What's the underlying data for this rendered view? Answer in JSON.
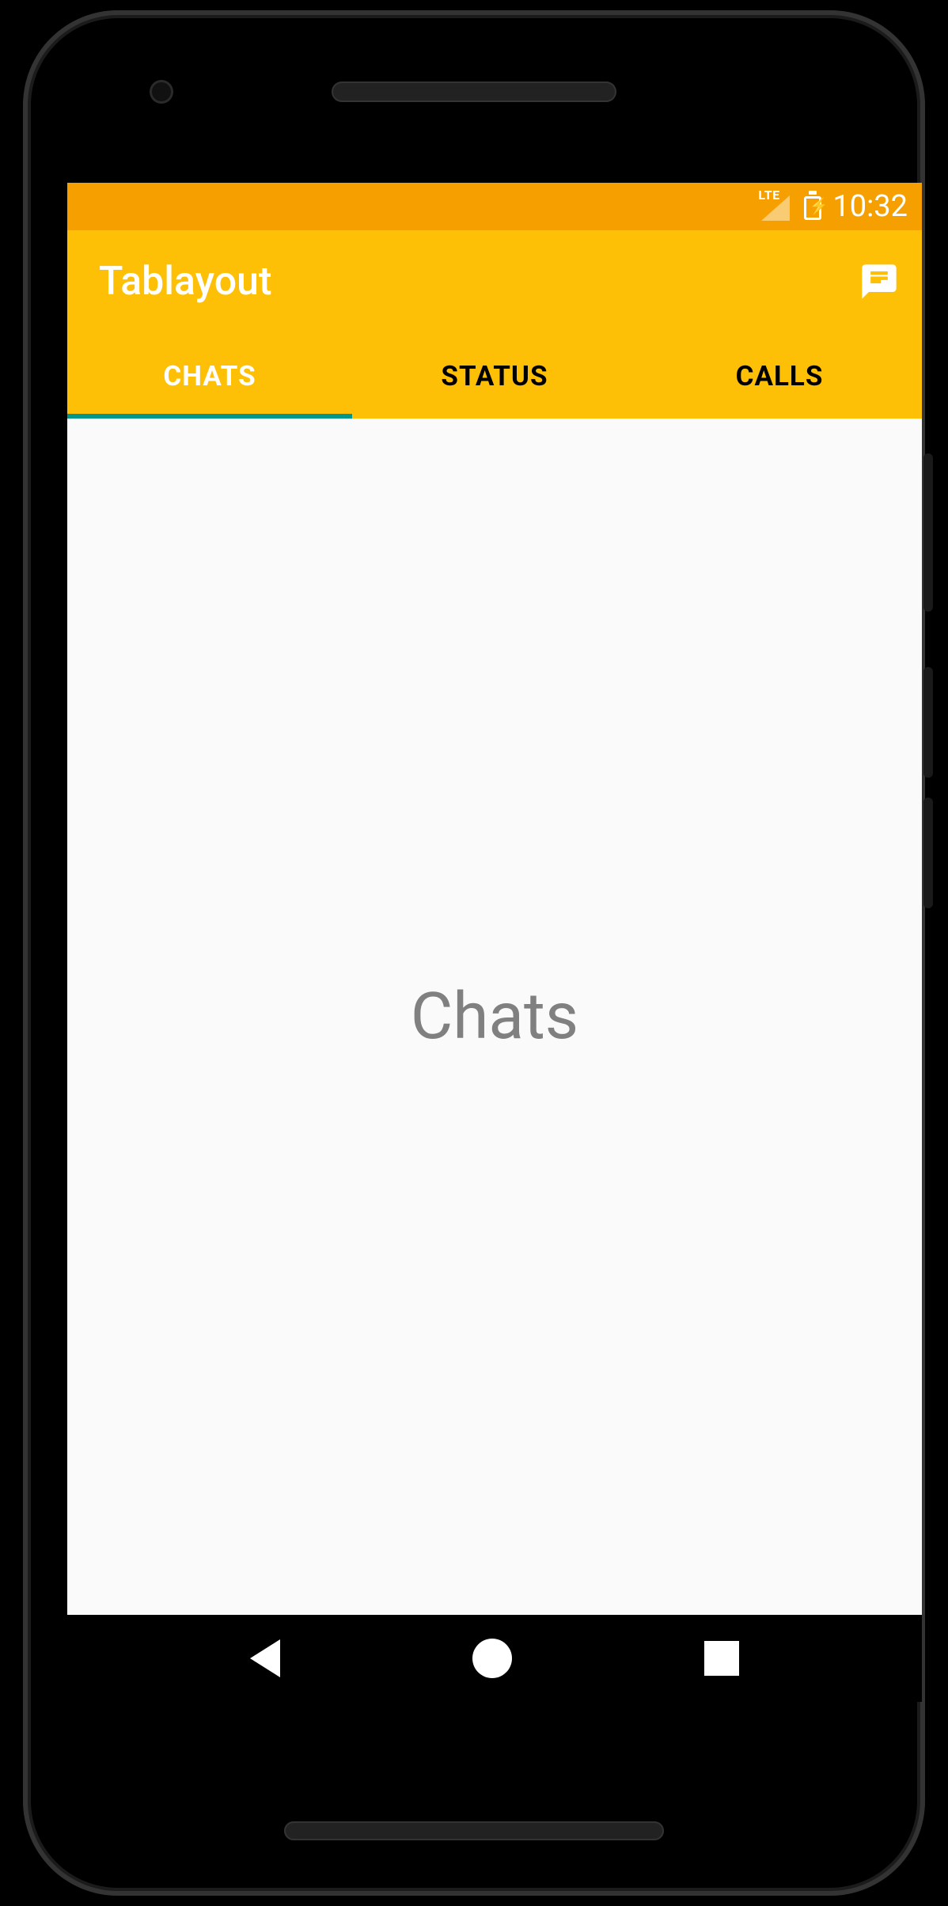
{
  "statusbar": {
    "network_label": "LTE",
    "time": "10:32"
  },
  "appbar": {
    "title": "Tablayout"
  },
  "tabs": [
    {
      "label": "CHATS",
      "active": true
    },
    {
      "label": "STATUS",
      "active": false
    },
    {
      "label": "CALLS",
      "active": false
    }
  ],
  "content": {
    "heading": "Chats"
  },
  "colors": {
    "status_bar": "#f5a000",
    "app_bar": "#fdc007",
    "tab_indicator": "#009688",
    "background": "#fafafa"
  }
}
